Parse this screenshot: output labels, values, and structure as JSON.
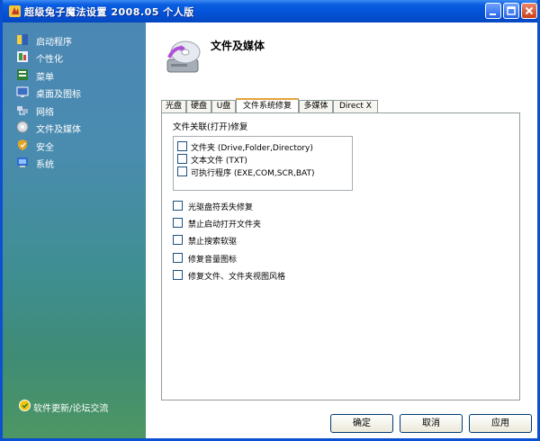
{
  "window": {
    "title": "超级兔子魔法设置 2008.05 个人版"
  },
  "sidebar": {
    "items": [
      {
        "label": "启动程序",
        "icon": "startup-icon"
      },
      {
        "label": "个性化",
        "icon": "personalize-icon"
      },
      {
        "label": "菜单",
        "icon": "menu-icon"
      },
      {
        "label": "桌面及图标",
        "icon": "desktop-icon"
      },
      {
        "label": "网络",
        "icon": "network-icon"
      },
      {
        "label": "文件及媒体",
        "icon": "file-media-icon"
      },
      {
        "label": "安全",
        "icon": "security-icon"
      },
      {
        "label": "系统",
        "icon": "system-icon"
      }
    ],
    "footer_link": "软件更新/论坛交流"
  },
  "main": {
    "title": "文件及媒体",
    "tabs": [
      "光盘",
      "硬盘",
      "U盘",
      "文件系统修复",
      "多媒体",
      "Direct X"
    ],
    "active_tab": "文件系统修复",
    "group_title": "文件关联(打开)修复",
    "group_items": [
      "文件夹 (Drive,Folder,Directory)",
      "文本文件 (TXT)",
      "可执行程序 (EXE,COM,SCR,BAT)"
    ],
    "options": [
      "光驱盘符丢失修复",
      "禁止启动打开文件夹",
      "禁止搜索软驱",
      "修复音量图标",
      "修复文件、文件夹视图风格"
    ]
  },
  "buttons": {
    "ok": "确定",
    "cancel": "取消",
    "apply": "应用"
  }
}
